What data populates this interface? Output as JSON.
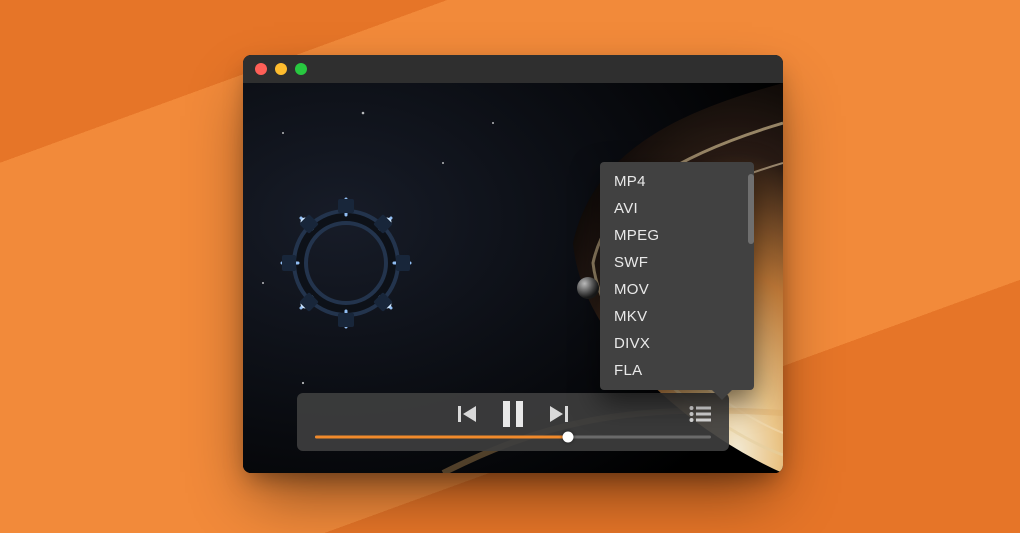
{
  "colors": {
    "accent": "#f18a2b",
    "window_chrome": "#2f2f2f",
    "panel": "#414141"
  },
  "formats": {
    "items": [
      "MP4",
      "AVI",
      "MPEG",
      "SWF",
      "MOV",
      "MKV",
      "DIVX",
      "FLA"
    ]
  },
  "playback": {
    "progress_percent": 64
  }
}
